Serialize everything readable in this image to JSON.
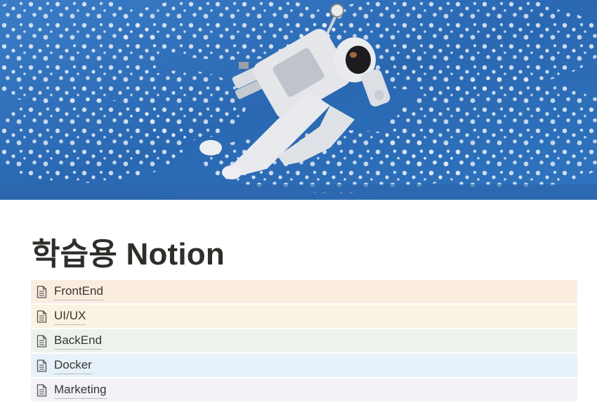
{
  "cover": {
    "description_icon": "astronaut-cover-image",
    "colors": {
      "ocean": "#2f6fb8",
      "cloud": "#eaf2fb",
      "suit": "#e6e6e9"
    }
  },
  "page": {
    "title": "학습용 Notion"
  },
  "links": [
    {
      "label": "FrontEnd",
      "icon": "page-icon",
      "color": "#fbece0"
    },
    {
      "label": "UI/UX",
      "icon": "page-icon",
      "color": "#fbf3e1"
    },
    {
      "label": "BackEnd",
      "icon": "page-icon",
      "color": "#edf3ec"
    },
    {
      "label": "Docker",
      "icon": "page-icon",
      "color": "#e7f1f9"
    },
    {
      "label": "Marketing",
      "icon": "page-icon",
      "color": "#f3f1f8"
    }
  ]
}
